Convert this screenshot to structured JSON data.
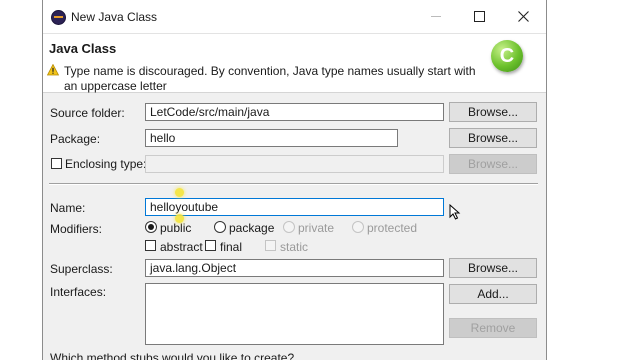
{
  "window": {
    "title": "New Java Class"
  },
  "header": {
    "title": "Java Class",
    "message": "Type name is discouraged. By convention, Java type names usually start with an uppercase letter",
    "icon": "new-class-wizard-icon"
  },
  "form": {
    "source_folder": {
      "label": "Source folder:",
      "value": "LetCode/src/main/java",
      "button": "Browse..."
    },
    "package": {
      "label": "Package:",
      "value": "hello",
      "button": "Browse..."
    },
    "enclosing_type": {
      "label": "Enclosing type:",
      "value": "",
      "button": "Browse..."
    },
    "name": {
      "label": "Name:",
      "value": "helloyoutube"
    },
    "modifiers": {
      "label": "Modifiers:",
      "public": "public",
      "package": "package",
      "private": "private",
      "protected": "protected",
      "abstract": "abstract",
      "final": "final",
      "static": "static"
    },
    "superclass": {
      "label": "Superclass:",
      "value": "java.lang.Object",
      "button": "Browse..."
    },
    "interfaces": {
      "label": "Interfaces:",
      "add_button": "Add...",
      "remove_button": "Remove"
    },
    "stubs_question": "Which method stubs would you like to create?"
  },
  "colors": {
    "focus": "#0078d7",
    "highlight": "#f5e53a",
    "wizard_icon": "#6cc12c"
  }
}
